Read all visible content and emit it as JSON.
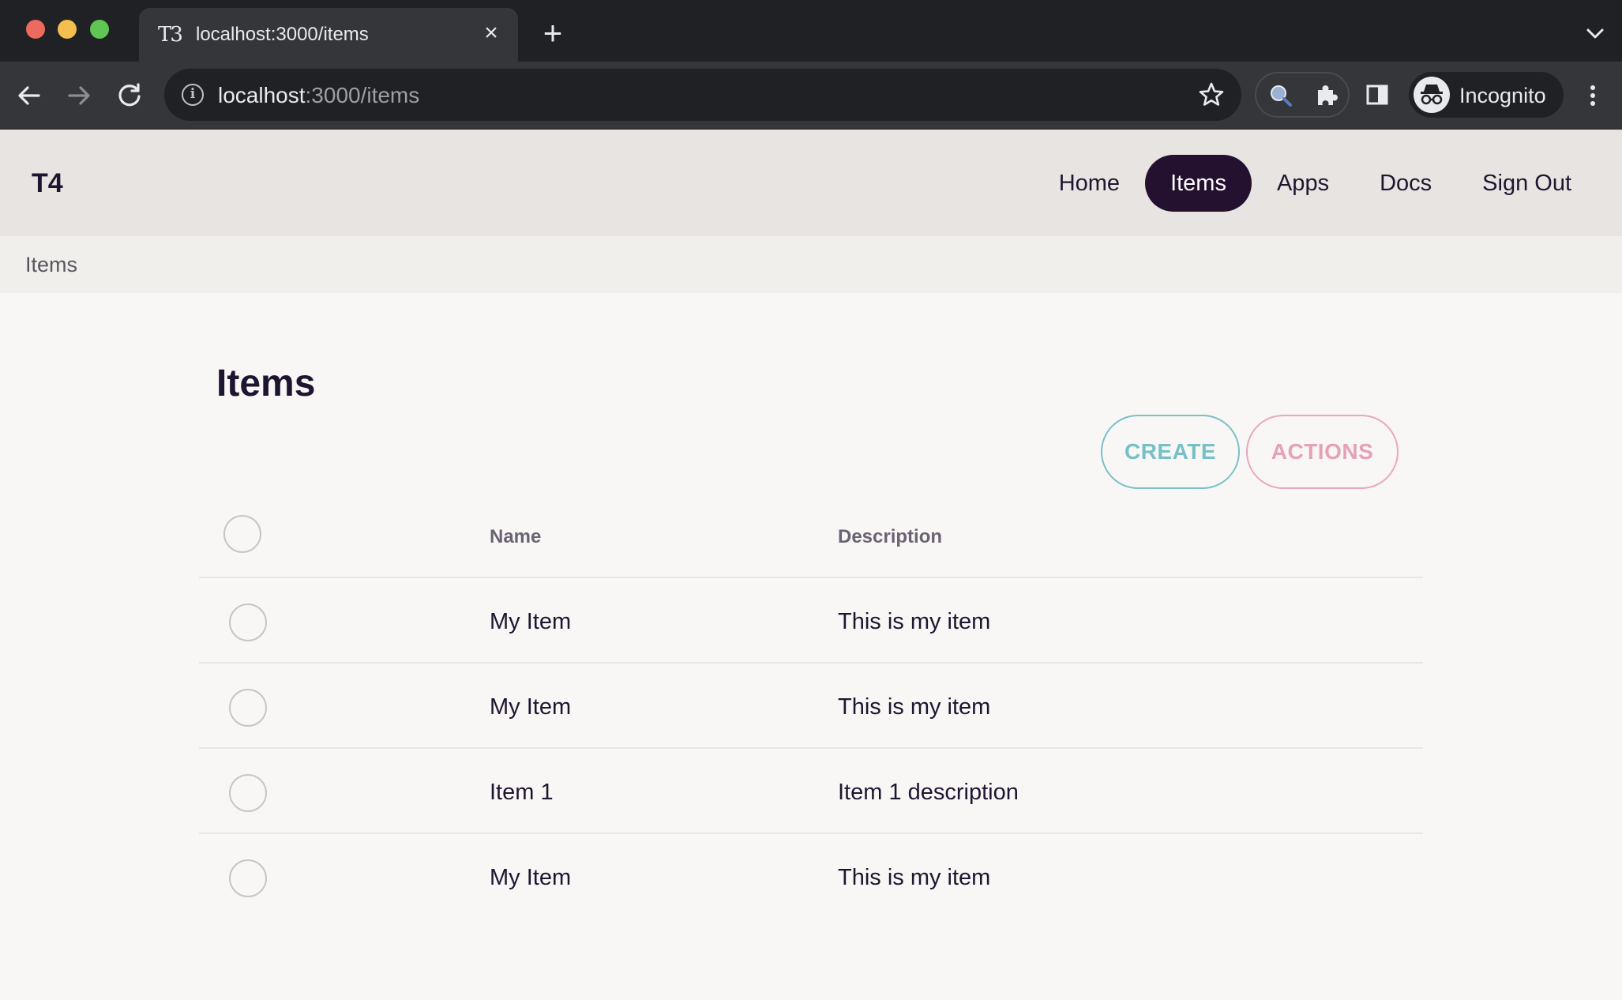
{
  "browser": {
    "tab_title": "localhost:3000/items",
    "favicon_text": "T3",
    "url_host": "localhost",
    "url_path": ":3000/items",
    "profile_label": "Incognito",
    "icons": [
      "close-icon",
      "plus-icon",
      "chevron-down-icon",
      "back-arrow-icon",
      "forward-arrow-icon",
      "reload-icon",
      "info-icon",
      "star-icon",
      "lens-icon",
      "puzzle-icon",
      "side-panel-icon",
      "incognito-icon",
      "kebab-menu-icon"
    ]
  },
  "header": {
    "brand": "T4",
    "nav": [
      {
        "label": "Home"
      },
      {
        "label": "Items",
        "active": true
      },
      {
        "label": "Apps"
      },
      {
        "label": "Docs"
      },
      {
        "label": "Sign Out"
      }
    ]
  },
  "breadcrumb": "Items",
  "main": {
    "title": "Items",
    "create_label": "CREATE",
    "actions_label": "ACTIONS",
    "columns": {
      "name": "Name",
      "description": "Description"
    },
    "rows": [
      {
        "name": "My Item",
        "description": "This is my item"
      },
      {
        "name": "My Item",
        "description": "This is my item"
      },
      {
        "name": "Item 1",
        "description": "Item 1 description"
      },
      {
        "name": "My Item",
        "description": "This is my item"
      }
    ]
  },
  "colors": {
    "active_nav": "#24112f",
    "create": "#76c0c8",
    "actions": "#e6a0b9",
    "text": "#1f1530"
  }
}
